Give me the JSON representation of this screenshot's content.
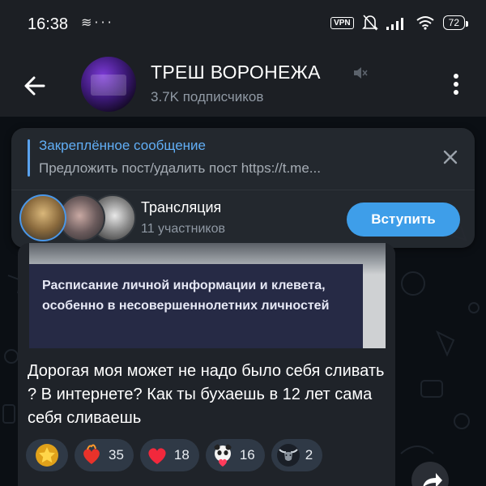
{
  "status_bar": {
    "time": "16:38",
    "left_icons": [
      "layers-icon",
      "more-dots-icon"
    ],
    "vpn_label": "VPN",
    "battery_level": "72"
  },
  "header": {
    "title": "ТРЕШ ВОРОНЕЖА",
    "subscribers": "3.7K подписчиков"
  },
  "pinned": {
    "title": "Закреплённое сообщение",
    "text": "Предложить пост/удалить пост https://t.me..."
  },
  "live": {
    "title": "Трансляция",
    "participants": "11 участников",
    "join_label": "Вступить"
  },
  "message": {
    "image_caption": "Расписание личной информации и клевета, особенно в несовершеннолетних личностей",
    "text": "Дорогая моя может не надо было себя сливать ? В интернете? Как ты бухаешь в 12 лет сама себя сливаешь",
    "reactions": [
      {
        "emoji": "star-icon",
        "count": ""
      },
      {
        "emoji": "burning-heart-icon",
        "count": "35"
      },
      {
        "emoji": "red-heart-icon",
        "count": "18"
      },
      {
        "emoji": "panda-heart-icon",
        "count": "16"
      },
      {
        "emoji": "bull-icon",
        "count": "2"
      }
    ]
  },
  "colors": {
    "accent": "#3e9ee9",
    "pinned_title": "#61aef5",
    "background": "#0b0f14",
    "header": "#1c1f24"
  }
}
